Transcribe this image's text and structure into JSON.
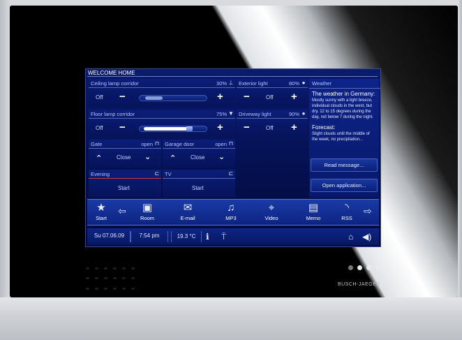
{
  "screen": {
    "title": "WELCOME HOME",
    "ceiling": {
      "label": "Ceiling lamp corridor",
      "value": "30%",
      "off": "Off",
      "level": 0.3,
      "icon": "lamp-icon"
    },
    "floor": {
      "label": "Floor lamp corridor",
      "value": "75%",
      "off": "Off",
      "level": 0.75,
      "icon": "floor-lamp-icon"
    },
    "exterior": {
      "label": "Exterior light",
      "value": "80%",
      "off": "Off",
      "icon": "bulb-icon"
    },
    "driveway": {
      "label": "Driveway light",
      "value": "90%",
      "off": "Off",
      "icon": "bulb-icon"
    },
    "gate": {
      "label": "Gate",
      "status": "open",
      "action": "Close",
      "icon": "gate-icon"
    },
    "garage": {
      "label": "Garage door",
      "status": "open",
      "action": "Close",
      "icon": "garage-icon"
    },
    "evening": {
      "label": "Evening",
      "action": "Start",
      "icon": "scene-icon"
    },
    "tv": {
      "label": "TV",
      "action": "Start",
      "icon": "scene-icon"
    },
    "weather": {
      "title": "Weather",
      "headline": "The weather in Germany:",
      "body": "Mostly sunny with a light breeze, individual clouds in the west, but dry. 12 to 15 degrees during the day, not below 7 during the night.",
      "forecast_title": "Forecast:",
      "forecast_body": "Slight clouds until the middle of the week, no precipitation...",
      "read_btn": "Read message...",
      "open_btn": "Open application..."
    },
    "nav": [
      {
        "label": "Start",
        "icon": "star-icon"
      },
      {
        "label": "Room",
        "icon": "room-icon"
      },
      {
        "label": "E-mail",
        "icon": "email-icon"
      },
      {
        "label": "MP3",
        "icon": "music-icon"
      },
      {
        "label": "Video",
        "icon": "video-icon"
      },
      {
        "label": "Memo",
        "icon": "memo-icon"
      },
      {
        "label": "RSS",
        "icon": "rss-icon"
      }
    ],
    "status": {
      "date": "Su 07.06.09",
      "time": "7:54 pm",
      "temp": "19.3 °C"
    }
  },
  "device": {
    "brand": "BUSCH-JAEGER"
  },
  "colors": {
    "screen_bg": "#04104e",
    "accent": "#1a3aa6",
    "alert_line": "#c23a3a"
  }
}
